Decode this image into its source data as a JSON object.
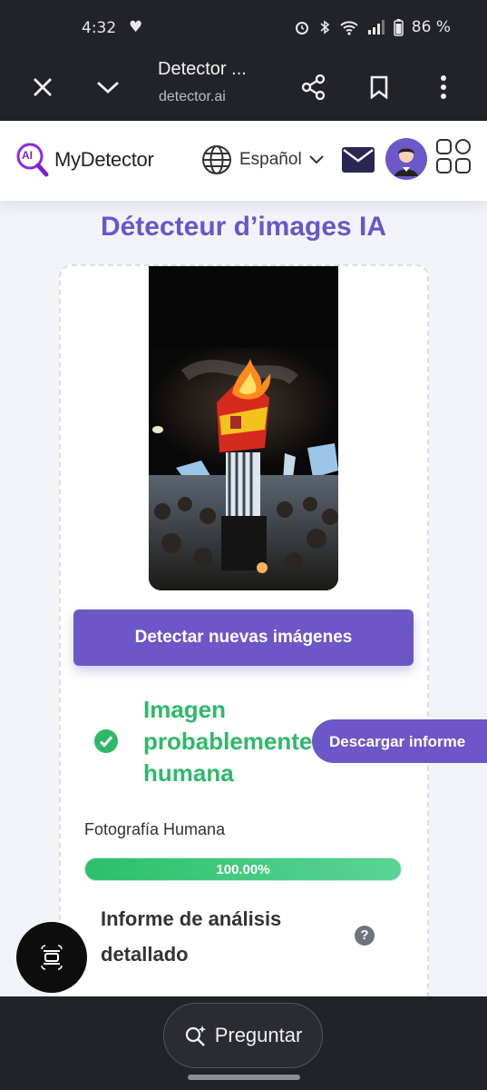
{
  "status_bar": {
    "time": "4:32",
    "battery": "86 %"
  },
  "browser": {
    "title": "Detector ...",
    "url": "detector.ai"
  },
  "header": {
    "logo_text": "MyDetector",
    "logo_badge": "AI",
    "language": "Español"
  },
  "main": {
    "title": "Détecteur d’images IA",
    "detect_button": "Detectar nuevas imágenes",
    "result_line1": "Imagen",
    "result_line2": "probablemente",
    "result_line3": "humana",
    "download_button": "Descargar informe",
    "classification_label": "Fotografía Humana",
    "confidence_text": "100.00%",
    "confidence_value": 1.0,
    "report_line1": "Informe de análisis",
    "report_line2": "detallado",
    "help_symbol": "?"
  },
  "bottom": {
    "ask_label": "Preguntar"
  },
  "colors": {
    "accent": "#6c57c9",
    "success": "#2eb969",
    "bar_bg": "#222326"
  },
  "icons": [
    "close-icon",
    "chevron-down-icon",
    "share-icon",
    "bookmark-icon",
    "more-icon",
    "globe-icon",
    "mail-icon",
    "avatar-icon",
    "apps-grid-icon",
    "check-icon",
    "help-icon",
    "scan-icon",
    "sparkle-search-icon"
  ]
}
